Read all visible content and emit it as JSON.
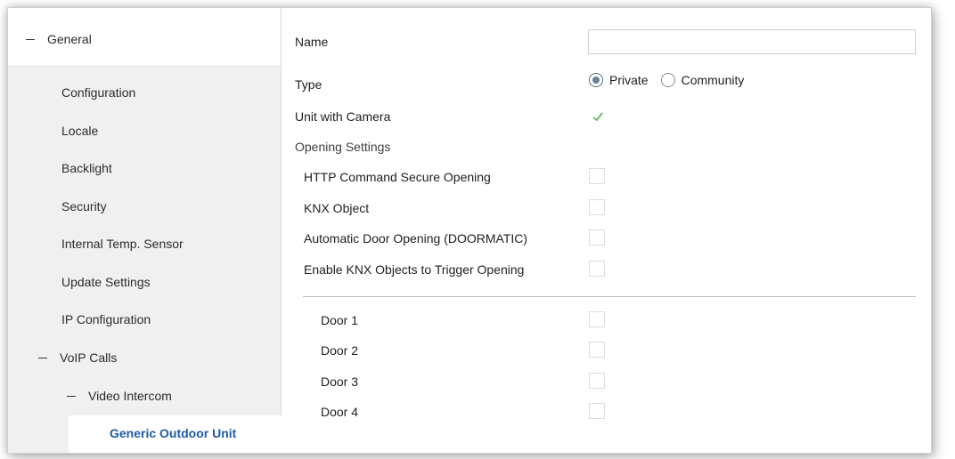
{
  "sidebar": {
    "general": "General",
    "items": [
      "Configuration",
      "Locale",
      "Backlight",
      "Security",
      "Internal Temp. Sensor",
      "Update Settings",
      "IP Configuration"
    ],
    "voip_calls": "VoIP Calls",
    "video_intercom": "Video Intercom",
    "selected": "Generic Outdoor Unit"
  },
  "form": {
    "name_label": "Name",
    "name_value": "",
    "type_label": "Type",
    "type_options": [
      "Private",
      "Community"
    ],
    "type_selected": "Private",
    "camera_label": "Unit with Camera",
    "camera_checked": true,
    "opening_section": "Opening Settings",
    "opening_options": [
      {
        "label": "HTTP Command Secure Opening",
        "checked": false
      },
      {
        "label": "KNX Object",
        "checked": false
      },
      {
        "label": "Automatic Door Opening (DOORMATIC)",
        "checked": false
      },
      {
        "label": "Enable KNX Objects to Trigger Opening",
        "checked": false
      }
    ],
    "doors": [
      {
        "label": "Door 1",
        "checked": false
      },
      {
        "label": "Door 2",
        "checked": false
      },
      {
        "label": "Door 3",
        "checked": false
      },
      {
        "label": "Door 4",
        "checked": false
      }
    ]
  },
  "colors": {
    "accent": "#1e5aa8",
    "check": "#6fbf6a"
  }
}
